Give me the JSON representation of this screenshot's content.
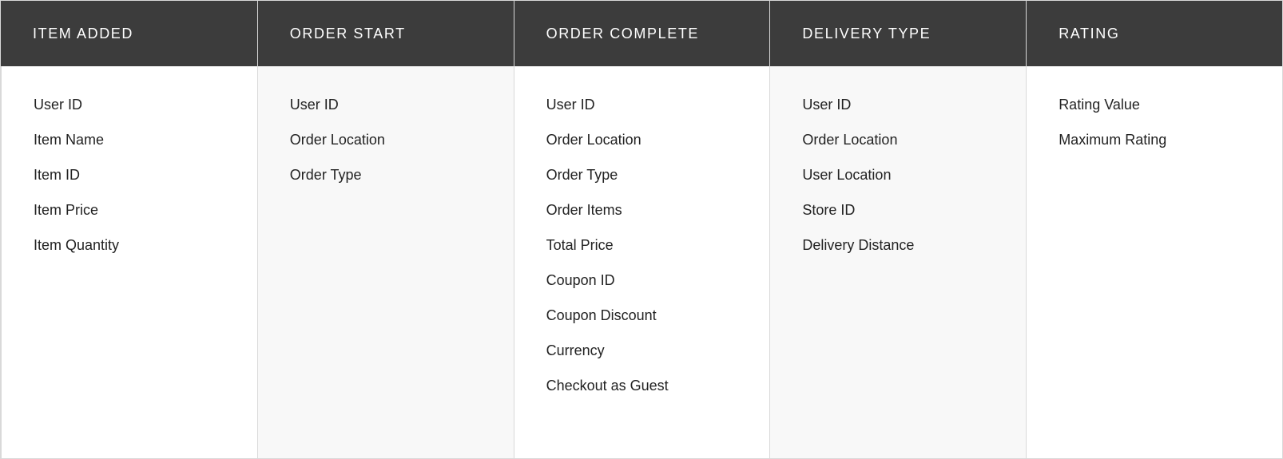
{
  "columns": [
    {
      "header": "ITEM ADDED",
      "alt": false,
      "items": [
        "User ID",
        "Item Name",
        "Item ID",
        "Item Price",
        "Item Quantity"
      ]
    },
    {
      "header": "ORDER START",
      "alt": true,
      "items": [
        "User ID",
        "Order Location",
        "Order Type"
      ]
    },
    {
      "header": "ORDER COMPLETE",
      "alt": false,
      "items": [
        "User ID",
        "Order Location",
        "Order Type",
        "Order Items",
        "Total Price",
        "Coupon ID",
        "Coupon Discount",
        "Currency",
        "Checkout as Guest"
      ]
    },
    {
      "header": "DELIVERY TYPE",
      "alt": true,
      "items": [
        "User ID",
        "Order Location",
        "User Location",
        "Store ID",
        "Delivery Distance"
      ]
    },
    {
      "header": "RATING",
      "alt": false,
      "items": [
        "Rating Value",
        "Maximum Rating"
      ]
    }
  ]
}
